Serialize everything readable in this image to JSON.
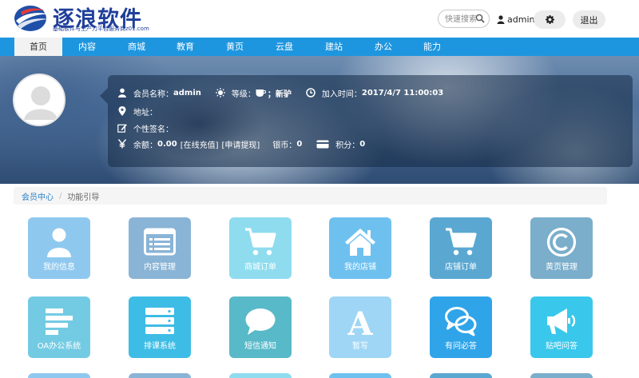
{
  "header": {
    "logo_title": "逐浪软件",
    "logo_subtitle": "基础软件与生产力平台服务商z01.com",
    "search_placeholder": "快速搜索",
    "username": "admin",
    "logout_label": "退出"
  },
  "nav": {
    "items": [
      "首页",
      "内容",
      "商城",
      "教育",
      "黄页",
      "云盘",
      "建站",
      "办公",
      "能力"
    ],
    "active": "首页"
  },
  "profile": {
    "member_name_label": "会员名称：",
    "member_name": "admin",
    "level_label": "等级：",
    "level_value": "；新驴",
    "join_label": "加入时间：",
    "join_time": "2017/4/7 11:00:03",
    "address_label": "地址：",
    "signature_label": "个性签名：",
    "balance_label": "余额：",
    "balance": "0.00",
    "recharge_link": "[在线充值]",
    "withdraw_link": "[申请提现]",
    "silver_label": "银币：",
    "silver": "0",
    "points_label": "积分：",
    "points": "0"
  },
  "breadcrumb": {
    "home": "会员中心",
    "separator": "/",
    "current": "功能引导"
  },
  "tiles": [
    {
      "label": "我的信息",
      "icon": "user-icon",
      "color": "#8fc8ef"
    },
    {
      "label": "内容管理",
      "icon": "list-window-icon",
      "color": "#8ab4d6"
    },
    {
      "label": "商城订单",
      "icon": "cart-icon",
      "color": "#8fdcef"
    },
    {
      "label": "我的店铺",
      "icon": "home-icon",
      "color": "#6ec1ef"
    },
    {
      "label": "店铺订单",
      "icon": "cart-icon",
      "color": "#5aa8d2"
    },
    {
      "label": "黄页管理",
      "icon": "copyright-icon",
      "color": "#7aaecb"
    },
    {
      "label": "OA办公系统",
      "icon": "bars-icon",
      "color": "#73cbe3"
    },
    {
      "label": "排课系统",
      "icon": "server-icon",
      "color": "#3dbce5"
    },
    {
      "label": "短信通知",
      "icon": "speech-bubble-icon",
      "color": "#58b9c8"
    },
    {
      "label": "暂写",
      "icon": "letter-a-icon",
      "color": "#9fd6f5"
    },
    {
      "label": "有问必答",
      "icon": "chat-bubbles-icon",
      "color": "#2fa4e9"
    },
    {
      "label": "贴吧问答",
      "icon": "megaphone-icon",
      "color": "#39c8ec"
    }
  ]
}
